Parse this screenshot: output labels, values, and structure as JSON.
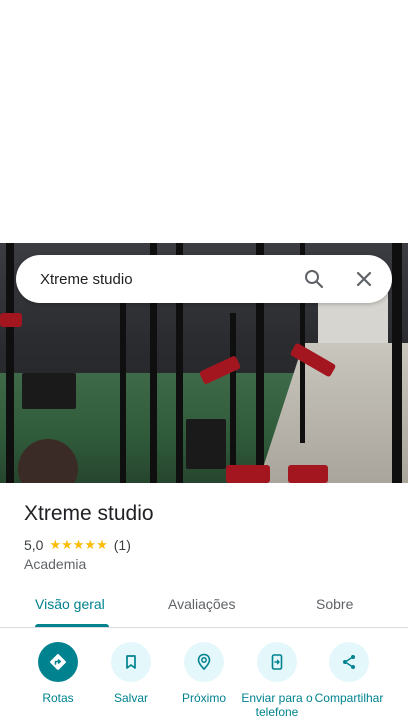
{
  "search": {
    "query": "Xtreme studio"
  },
  "place": {
    "name": "Xtreme studio",
    "rating": "5,0",
    "stars": "★★★★★",
    "review_count": "(1)",
    "category": "Academia"
  },
  "tabs": [
    {
      "label": "Visão geral",
      "active": true
    },
    {
      "label": "Avaliações",
      "active": false
    },
    {
      "label": "Sobre",
      "active": false
    }
  ],
  "actions": [
    {
      "label": "Rotas",
      "icon": "directions-icon"
    },
    {
      "label": "Salvar",
      "icon": "bookmark-icon"
    },
    {
      "label": "Próximo",
      "icon": "nearby-icon"
    },
    {
      "label": "Enviar para o telefone",
      "icon": "send-to-phone-icon"
    },
    {
      "label": "Compartilhar",
      "icon": "share-icon"
    }
  ],
  "colors": {
    "accent": "#00838f",
    "accent_light": "#e4f7fb",
    "star": "#fbbc04"
  }
}
